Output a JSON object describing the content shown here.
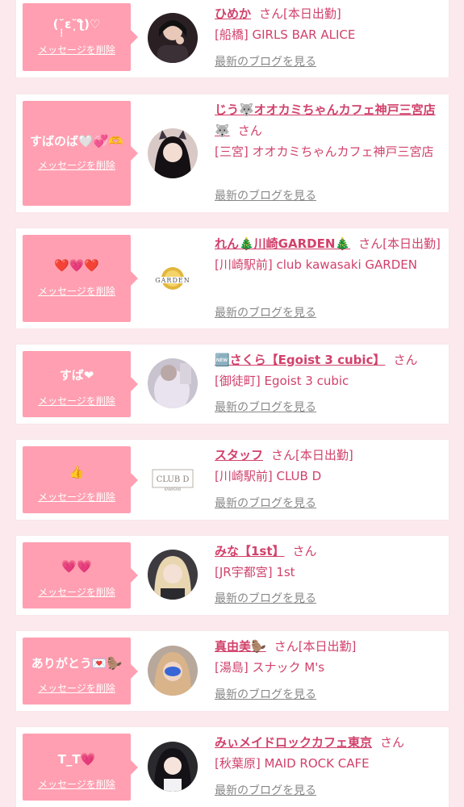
{
  "common": {
    "delete_label": "メッセージを削除",
    "blog_label": "最新のブログを見る",
    "san": "さん"
  },
  "colors": {
    "page_bg": "#fbe9ee",
    "bubble_bg": "#ff9fb1",
    "accent_text": "#d1416b",
    "link_gray": "#888888"
  },
  "messages": [
    {
      "bubble": "(˘̩̩̩ε˘̩ƪ)♡",
      "name": "ひめか",
      "status": "[本日出勤]",
      "shop": "[船橋] GIRLS BAR ALICE",
      "avatar": "photo-dark-hair"
    },
    {
      "bubble": "すばのば🤍💞🫶",
      "name": "じう🐺オオカミちゃんカフェ神戸三宮店🐺",
      "status": "",
      "shop": "[三宮] オオカミちゃんカフェ神戸三宮店",
      "avatar": "photo-wolf-ears"
    },
    {
      "bubble": "❤️💗❤️",
      "name": "れん🎄川崎GARDEN🎄",
      "status": "[本日出勤]",
      "shop": "[川崎駅前] club kawasaki GARDEN",
      "avatar": "logo-garden"
    },
    {
      "bubble": "すば❤",
      "name": "🆕さくら【Egoist 3 cubic】",
      "status": "",
      "shop": "[御徒町] Egoist 3 cubic",
      "avatar": "photo-light-outfit"
    },
    {
      "bubble": "👍",
      "name": "スタッフ",
      "status": "[本日出勤]",
      "shop": "[川崎駅前] CLUB D",
      "avatar": "logo-club-d"
    },
    {
      "bubble": "💗💗",
      "name": "みな【1st】",
      "status": "",
      "shop": "[JR宇都宮] 1st",
      "avatar": "photo-blonde"
    },
    {
      "bubble": "ありがとう💌🦫",
      "name": "真由美🦫",
      "status": "[本日出勤]",
      "shop": "[湯島] スナック M's",
      "avatar": "photo-blurred-face"
    },
    {
      "bubble": "T_T💗",
      "name": "みぃメイドロックカフェ東京",
      "status": "",
      "shop": "[秋葉原] MAID ROCK CAFE",
      "avatar": "photo-maid"
    }
  ]
}
